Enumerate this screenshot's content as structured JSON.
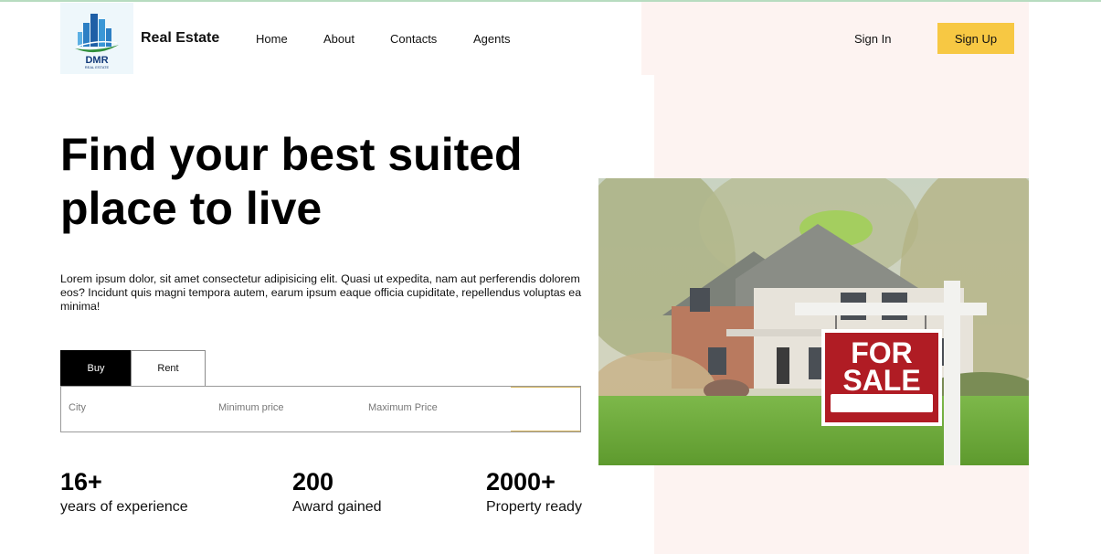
{
  "brand": {
    "name": "Real Estate",
    "logo_text": "DMR",
    "logo_subtext": "REAL ESTATE"
  },
  "nav": {
    "items": [
      "Home",
      "About",
      "Contacts",
      "Agents"
    ],
    "sign_in": "Sign In",
    "sign_up": "Sign Up"
  },
  "hero": {
    "headline": "Find your best suited place to live",
    "description": "Lorem ipsum dolor, sit amet consectetur adipisicing elit. Quasi ut expedita, nam aut perferendis dolorem eos? Incidunt quis magni tempora autem, earum ipsum eaque officia cupiditate, repellendus voluptas ea minima!"
  },
  "search": {
    "tabs": [
      "Buy",
      "Rent"
    ],
    "active_tab": "Buy",
    "city_placeholder": "City",
    "min_price_placeholder": "Minimum price",
    "max_price_placeholder": "Maximum Price"
  },
  "stats": [
    {
      "value": "16+",
      "label": "years of experience"
    },
    {
      "value": "200",
      "label": "Award gained"
    },
    {
      "value": "2000+",
      "label": "Property ready"
    }
  ],
  "photo": {
    "sign_line1": "FOR",
    "sign_line2": "SALE"
  },
  "colors": {
    "accent": "#f7c843",
    "pink_bg": "#fdf3f1",
    "sign_red": "#b01c24"
  }
}
